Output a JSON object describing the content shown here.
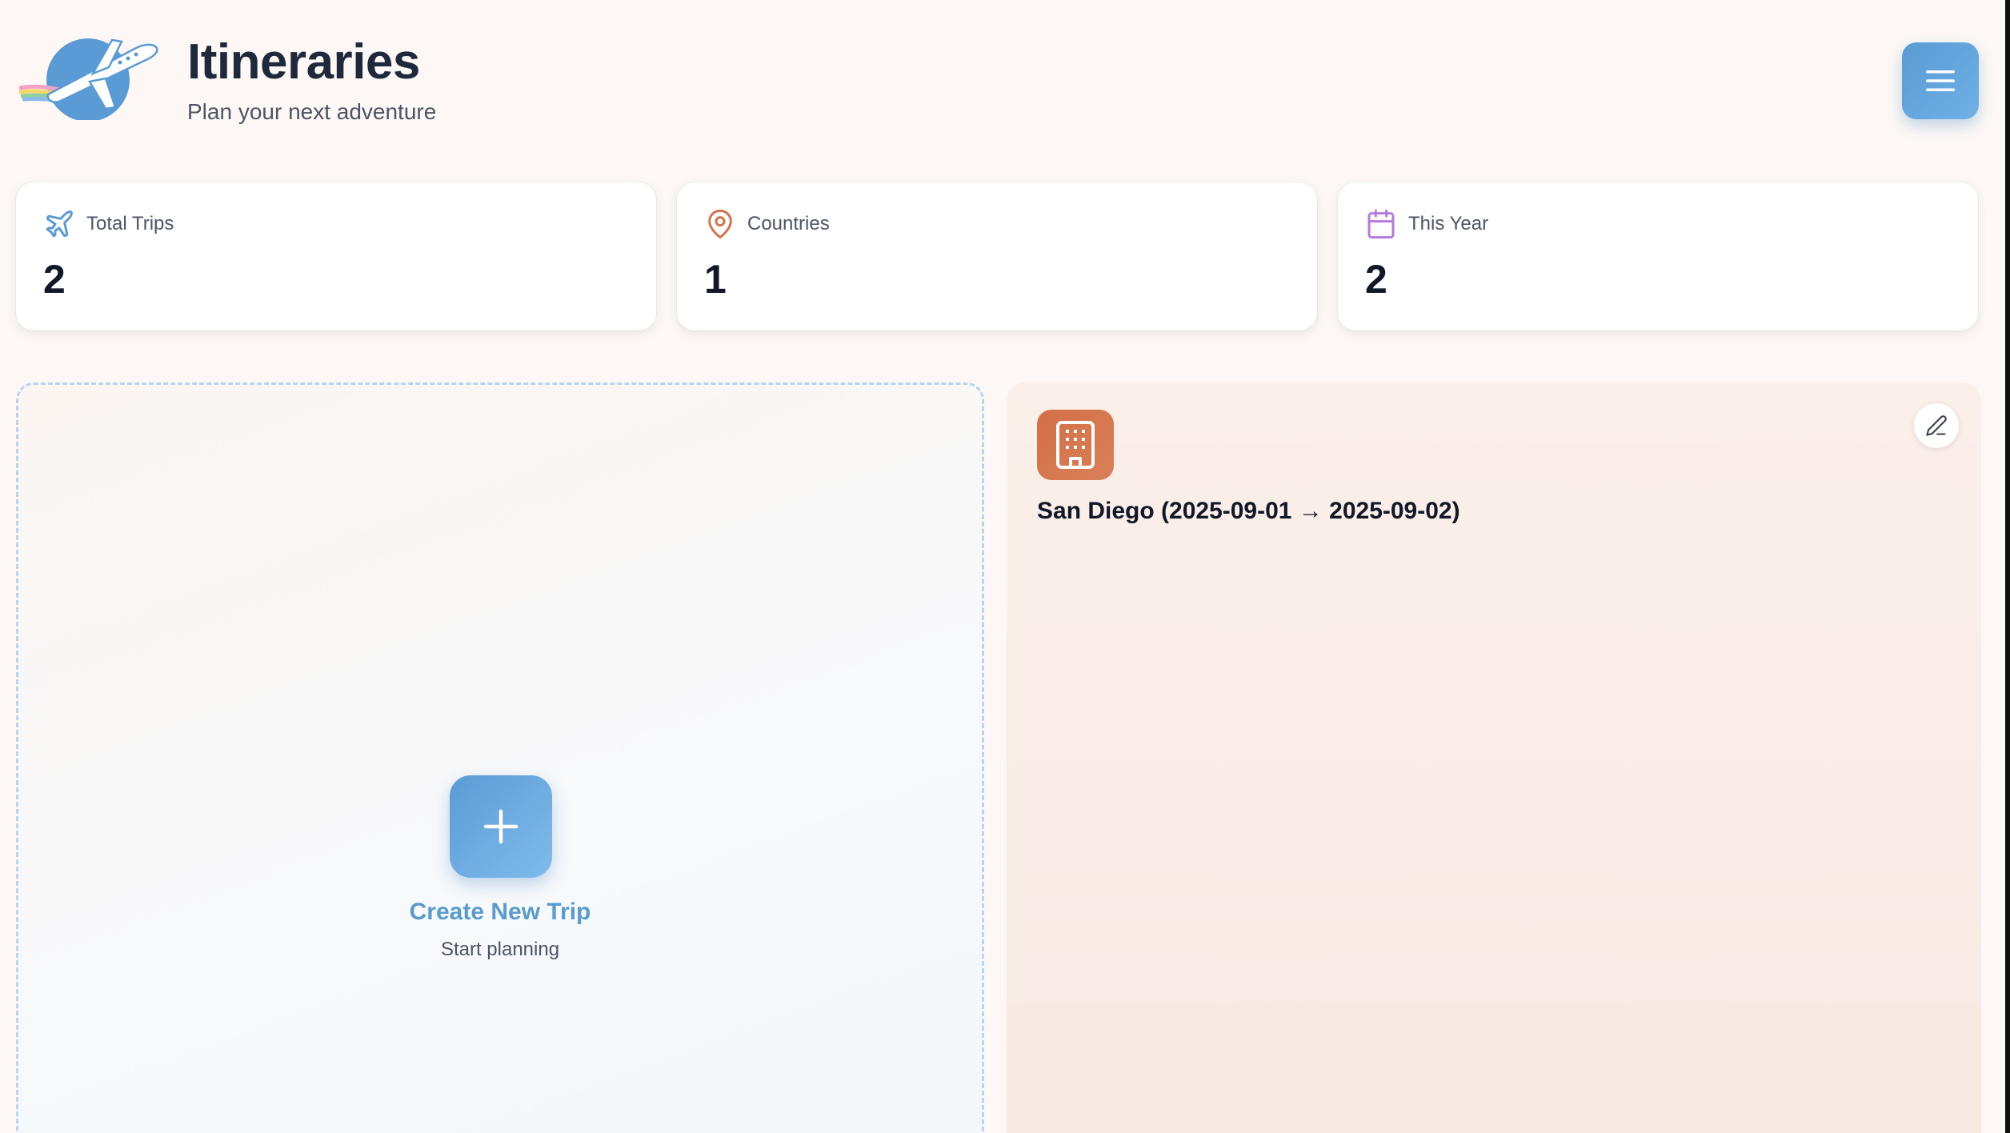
{
  "header": {
    "title": "Itineraries",
    "subtitle": "Plan your next adventure",
    "logo_icon": "airplane-globe-logo",
    "menu_icon": "hamburger-menu-icon"
  },
  "stats": [
    {
      "label": "Total Trips",
      "value": "2",
      "icon": "plane-icon",
      "color": "#5b9bd5"
    },
    {
      "label": "Countries",
      "value": "1",
      "icon": "map-pin-icon",
      "color": "#d0754e"
    },
    {
      "label": "This Year",
      "value": "2",
      "icon": "calendar-icon",
      "color": "#b57bdc"
    }
  ],
  "create_trip": {
    "label": "Create New Trip",
    "sublabel": "Start planning",
    "icon": "plus-icon"
  },
  "trips": [
    {
      "title": "San Diego (2025-09-01 → 2025-09-02)",
      "icon": "building-icon",
      "edit_icon": "pencil-icon"
    }
  ],
  "colors": {
    "accent_blue": "#5b9bd5",
    "accent_orange": "#d36f48",
    "accent_purple": "#b57bdc",
    "background": "#fdf8f5"
  }
}
